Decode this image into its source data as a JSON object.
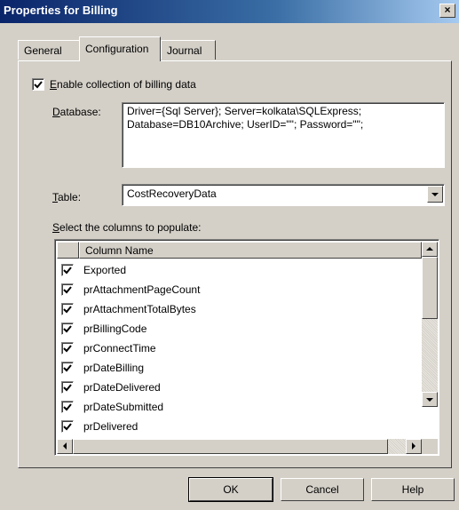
{
  "window": {
    "title": "Properties for Billing",
    "close_glyph": "×"
  },
  "tabs": [
    {
      "label": "General",
      "active": false
    },
    {
      "label": "Configuration",
      "active": true
    },
    {
      "label": "Journal",
      "active": false
    }
  ],
  "enable": {
    "label_accel": "E",
    "label_rest": "nable collection of billing data",
    "checked": true
  },
  "database": {
    "label_accel": "D",
    "label_rest": "atabase:",
    "value": "Driver={Sql Server}; Server=kolkata\\SQLExpress;\nDatabase=DB10Archive; UserID=\"\"; Password=\"\";"
  },
  "table": {
    "label_accel": "T",
    "label_rest": "able:",
    "value": "CostRecoveryData"
  },
  "columns": {
    "label_accel": "S",
    "label_rest": "elect the columns to populate:",
    "header": "Column Name",
    "rows": [
      {
        "name": "Exported",
        "checked": true
      },
      {
        "name": "prAttachmentPageCount",
        "checked": true
      },
      {
        "name": "prAttachmentTotalBytes",
        "checked": true
      },
      {
        "name": "prBillingCode",
        "checked": true
      },
      {
        "name": "prConnectTime",
        "checked": true
      },
      {
        "name": "prDateBilling",
        "checked": true
      },
      {
        "name": "prDateDelivered",
        "checked": true
      },
      {
        "name": "prDateSubmitted",
        "checked": true
      },
      {
        "name": "prDelivered",
        "checked": true
      }
    ]
  },
  "buttons": {
    "ok": "OK",
    "cancel": "Cancel",
    "help": "Help"
  },
  "icons": {
    "close": "close-icon",
    "check": "checkmark-icon",
    "dropdown": "chevron-down-icon",
    "scroll_up": "arrow-up-icon",
    "scroll_down": "arrow-down-icon",
    "scroll_left": "arrow-left-icon",
    "scroll_right": "arrow-right-icon"
  },
  "colors": {
    "titlebar_start": "#0a246a",
    "titlebar_end": "#a6caf0",
    "face": "#d4d0c8"
  }
}
